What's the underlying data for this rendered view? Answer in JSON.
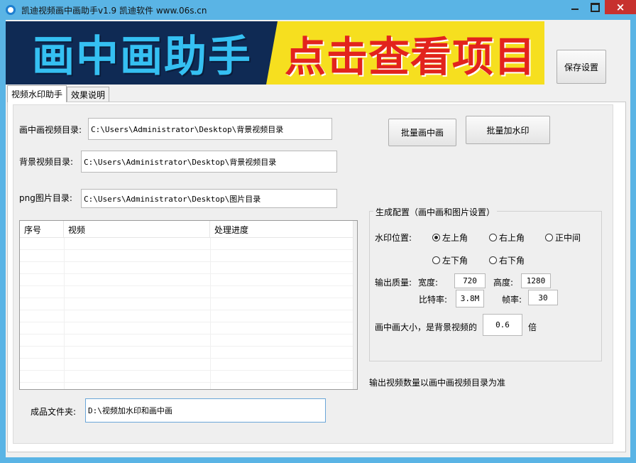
{
  "window": {
    "title": "凯迪视频画中画助手v1.9    凯迪软件 www.06s.cn",
    "icon": "app-icon",
    "controls": {
      "minimize": "minimize-icon",
      "maximize": "maximize-icon",
      "close": "×"
    }
  },
  "banner": {
    "left_text": "画中画助手",
    "right_text": "点击查看项目",
    "colors": {
      "left_bg": "#0f2a54",
      "left_fg": "#35c0f2",
      "right_bg": "#f6df1f",
      "right_fg": "#e2231d"
    }
  },
  "buttons": {
    "save_settings": "保存设置",
    "batch_pip": "批量画中画",
    "batch_watermark": "批量加水印"
  },
  "tabs": [
    "视频水印助手",
    "效果说明"
  ],
  "fields": {
    "pip_dir": {
      "label": "画中画视频目录:",
      "value": "C:\\Users\\Administrator\\Desktop\\背景视频目录"
    },
    "bg_dir": {
      "label": "背景视频目录:",
      "value": "C:\\Users\\Administrator\\Desktop\\背景视频目录"
    },
    "png_dir": {
      "label": "png图片目录:",
      "value": "C:\\Users\\Administrator\\Desktop\\图片目录"
    },
    "output_dir": {
      "label": "成品文件夹:",
      "value": "D:\\视频加水印和画中画"
    }
  },
  "listview": {
    "columns": [
      "序号",
      "视频",
      "处理进度"
    ],
    "rows": []
  },
  "config": {
    "group_title": "生成配置（画中画和图片设置）",
    "watermark_pos_label": "水印位置:",
    "positions": [
      "左上角",
      "右上角",
      "正中间",
      "左下角",
      "右下角"
    ],
    "selected_position": "左上角",
    "quality_label": "输出质量:",
    "width_label": "宽度:",
    "width_value": "720",
    "height_label": "高度:",
    "height_value": "1280",
    "bitrate_label": "比特率:",
    "bitrate_value": "3.8M",
    "fps_label": "帧率:",
    "fps_value": "30",
    "pip_size_label": "画中画大小，是背景视频的",
    "pip_size_value": "0.6",
    "pip_size_unit": "倍"
  },
  "note": "输出视频数量以画中画视频目录为准"
}
